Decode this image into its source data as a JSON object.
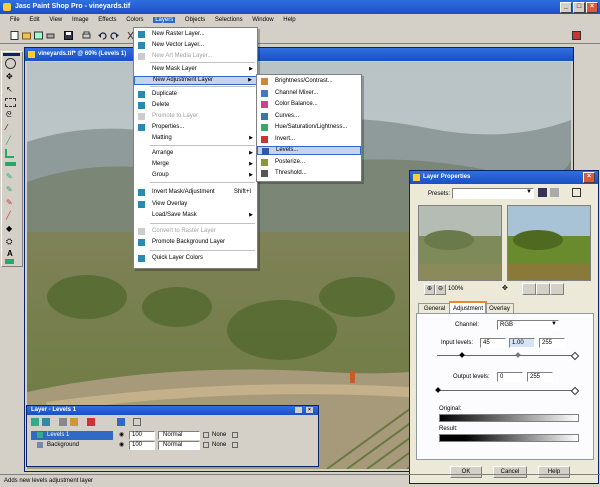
{
  "app": {
    "title": "Jasc Paint Shop Pro - vineyards.tif",
    "menu": [
      "File",
      "Edit",
      "View",
      "Image",
      "Effects",
      "Colors",
      "Layers",
      "Objects",
      "Selections",
      "Window",
      "Help"
    ]
  },
  "document": {
    "title": "vineyards.tif* @ 60% (Levels 1)"
  },
  "layers_menu": {
    "items": [
      {
        "label": "New Raster Layer...",
        "icon": "raster-layer-icon",
        "state": "normal"
      },
      {
        "label": "New Vector Layer...",
        "icon": "vector-layer-icon",
        "state": "normal"
      },
      {
        "label": "New Art Media Layer...",
        "icon": "art-media-icon",
        "state": "disabled"
      },
      {
        "label": "New Mask Layer",
        "icon": "",
        "state": "submenu"
      },
      {
        "label": "New Adjustment Layer",
        "icon": "",
        "state": "highlight"
      },
      {
        "label": "Duplicate",
        "icon": "duplicate-icon",
        "state": "normal"
      },
      {
        "label": "Delete",
        "icon": "delete-icon",
        "state": "normal"
      },
      {
        "label": "Promote to Layer",
        "icon": "promote-icon",
        "state": "disabled"
      },
      {
        "label": "Properties...",
        "icon": "properties-icon",
        "state": "normal"
      },
      {
        "label": "Matting",
        "icon": "",
        "state": "submenu"
      },
      {
        "label": "Arrange",
        "icon": "",
        "state": "submenu"
      },
      {
        "label": "Merge",
        "icon": "",
        "state": "submenu"
      },
      {
        "label": "Group",
        "icon": "",
        "state": "submenu"
      },
      {
        "label": "Invert Mask/Adjustment",
        "icon": "invert-icon",
        "state": "shortcut",
        "shortcut": "Shift+I"
      },
      {
        "label": "View Overlay",
        "icon": "overlay-icon",
        "state": "normal"
      },
      {
        "label": "Load/Save Mask",
        "icon": "",
        "state": "submenu"
      },
      {
        "label": "Convert to Raster Layer",
        "icon": "convert-icon",
        "state": "disabled"
      },
      {
        "label": "Promote Background Layer",
        "icon": "promote-bg-icon",
        "state": "normal"
      },
      {
        "label": "Quick Layer Colors",
        "icon": "layer-colors-icon",
        "state": "normal"
      }
    ]
  },
  "adjustment_submenu": {
    "items": [
      {
        "label": "Brightness/Contrast...",
        "icon": "brightness-icon"
      },
      {
        "label": "Channel Mixer...",
        "icon": "channel-mixer-icon"
      },
      {
        "label": "Color Balance...",
        "icon": "color-balance-icon"
      },
      {
        "label": "Curves...",
        "icon": "curves-icon"
      },
      {
        "label": "Hue/Saturation/Lightness...",
        "icon": "hue-icon"
      },
      {
        "label": "Invert...",
        "icon": "invert-icon"
      },
      {
        "label": "Levels...",
        "icon": "levels-icon"
      },
      {
        "label": "Posterize...",
        "icon": "posterize-icon"
      },
      {
        "label": "Threshold...",
        "icon": "threshold-icon"
      }
    ]
  },
  "layer_properties": {
    "title": "Layer Properties",
    "presets_label": "Presets:",
    "zoom": "100%",
    "tabs": [
      "General",
      "Adjustment",
      "Overlay"
    ],
    "channel_label": "Channel:",
    "channel_value": "RGB",
    "input_label": "Input levels:",
    "input_values": [
      "45",
      "1.00",
      "255"
    ],
    "output_label": "Output levels:",
    "output_values": [
      "0",
      "255"
    ],
    "original_label": "Original:",
    "result_label": "Result:",
    "ok": "OK",
    "cancel": "Cancel",
    "help": "Help"
  },
  "layers_palette": {
    "title": "Layer - Levels 1",
    "layers": [
      {
        "name": "Levels 1",
        "opacity": "100",
        "blend": "Normal",
        "selected": true
      },
      {
        "name": "Background",
        "opacity": "100",
        "blend": "Normal",
        "selected": false
      }
    ],
    "none_label": "None"
  },
  "status_bar": {
    "text": "Adds new levels adjustment layer"
  }
}
